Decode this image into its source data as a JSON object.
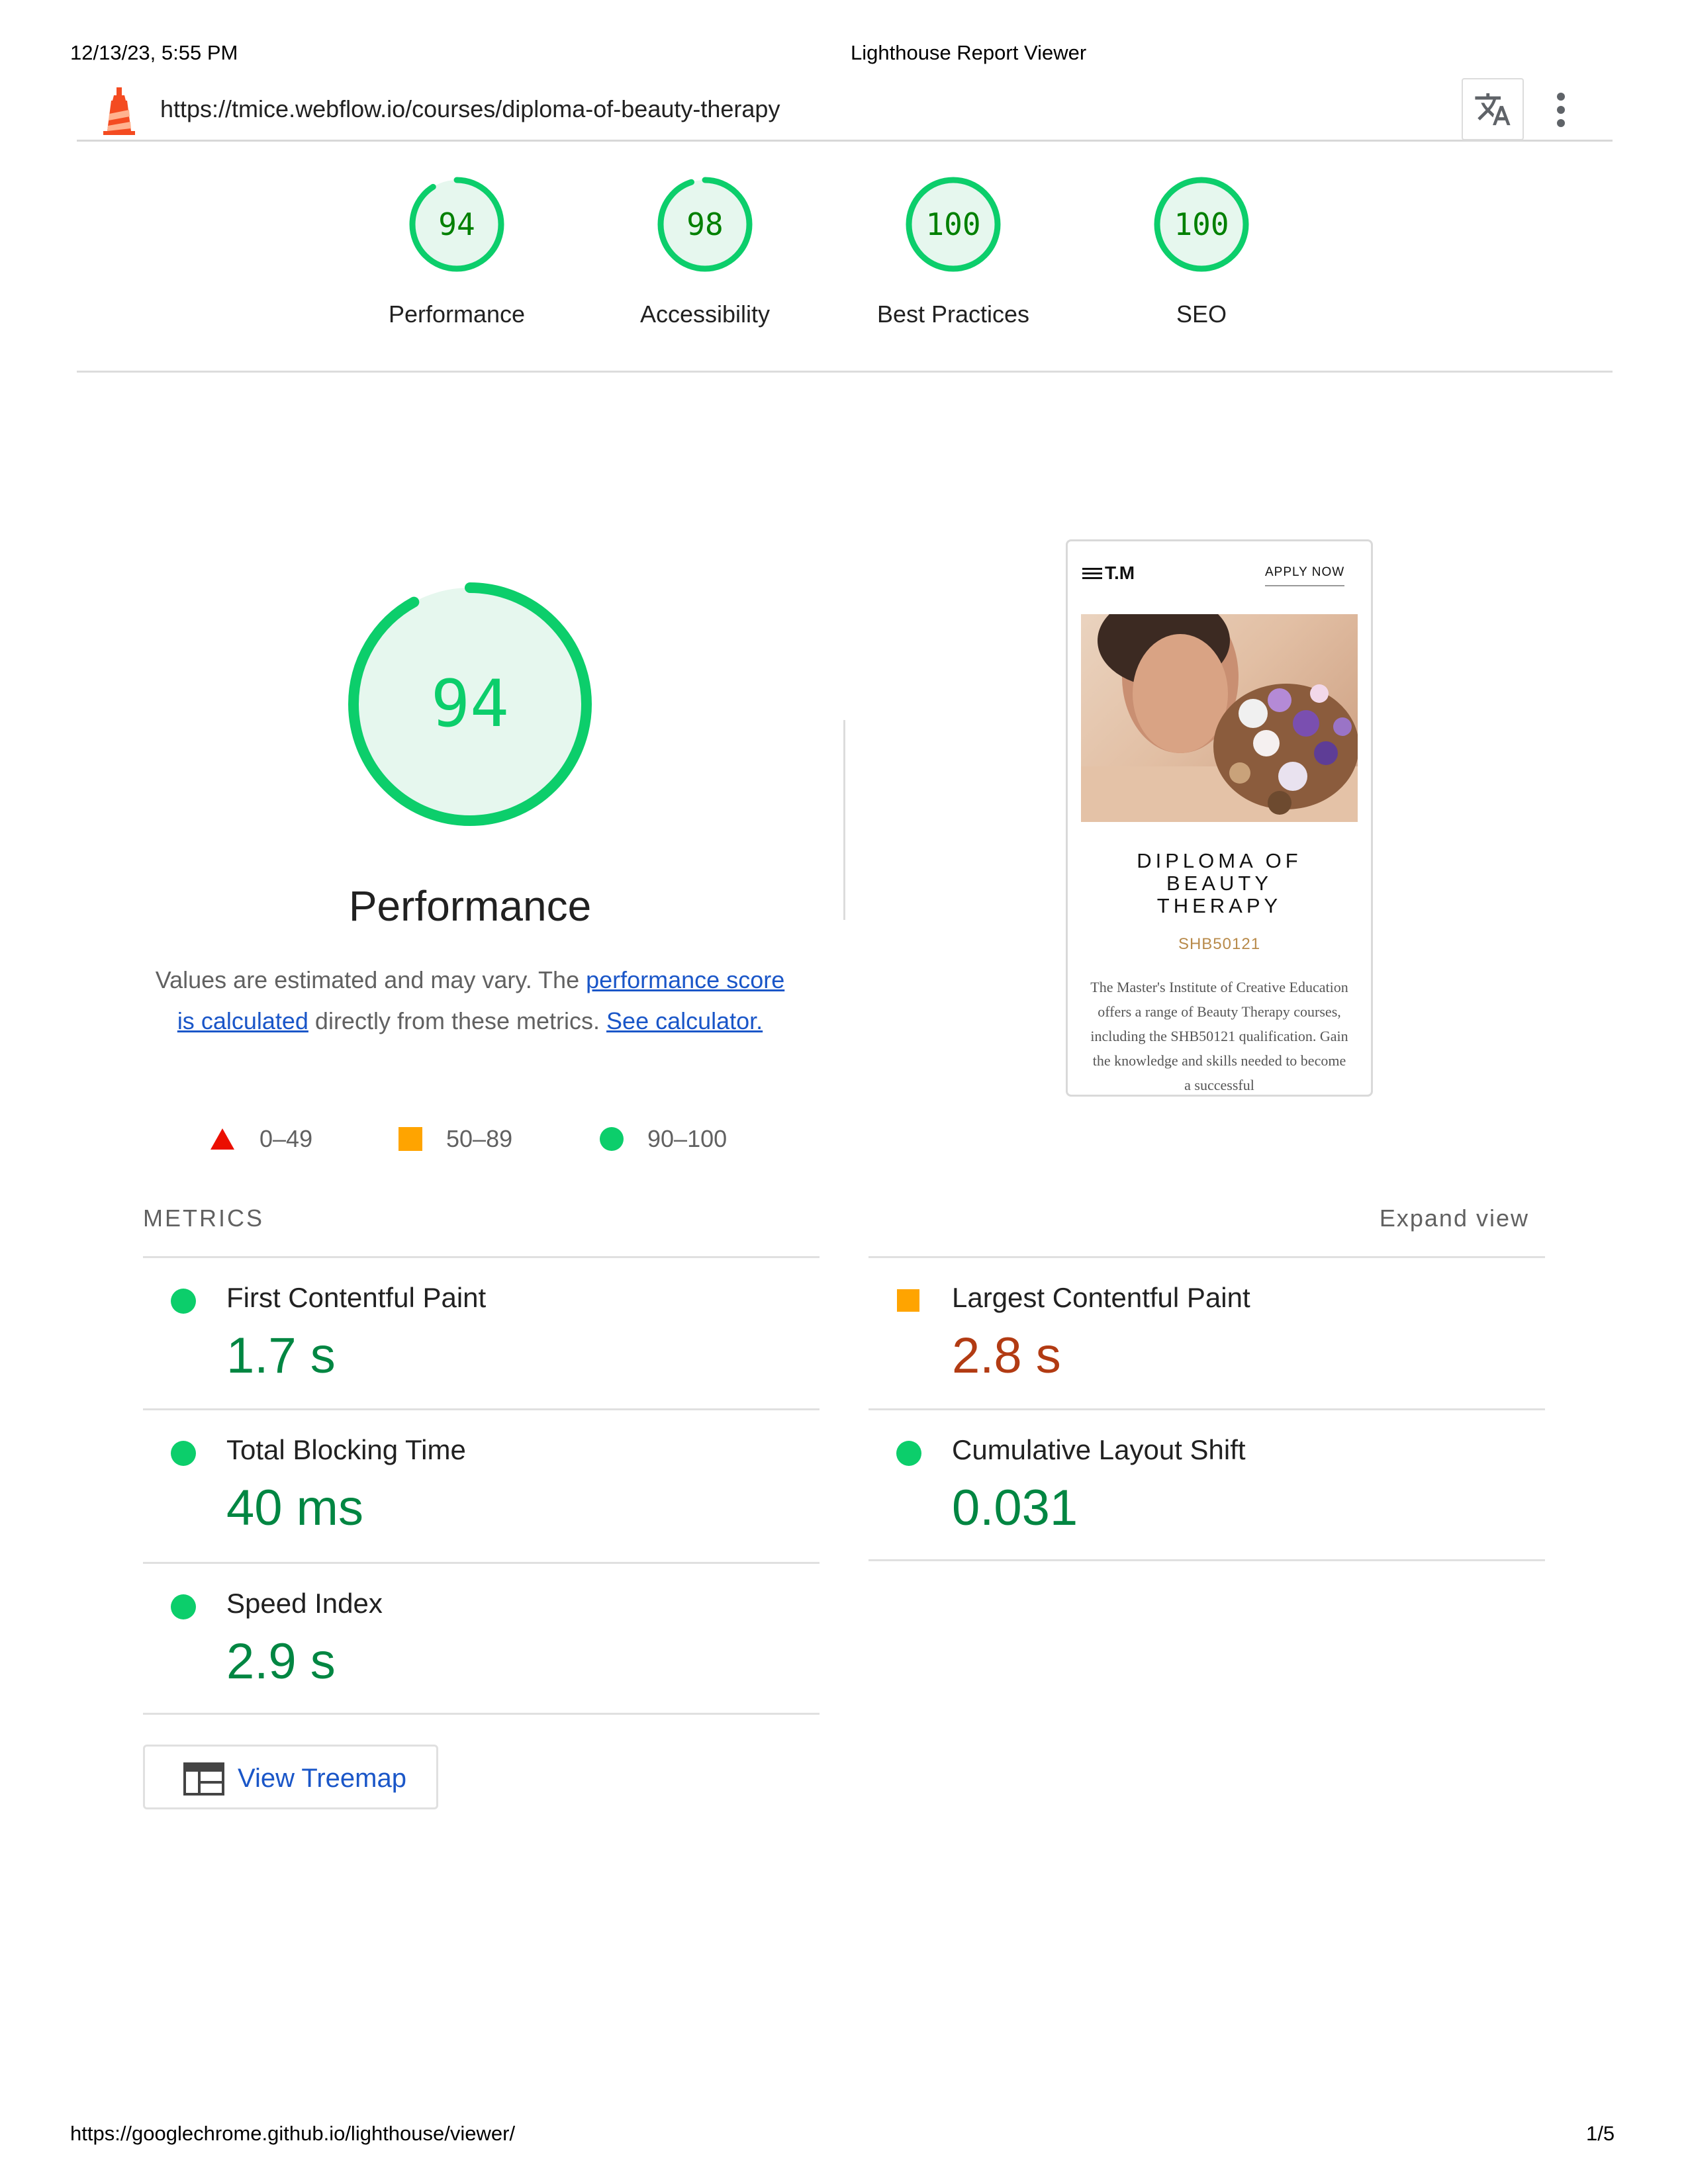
{
  "print_header": {
    "datetime": "12/13/23, 5:55 PM",
    "page_title": "Lighthouse Report Viewer"
  },
  "topbar": {
    "url": "https://tmice.webflow.io/courses/diploma-of-beauty-therapy",
    "translate_icon": "translate-icon",
    "menu_icon": "more-vert-icon"
  },
  "summary": [
    {
      "label": "Performance",
      "score": "94",
      "fraction": 0.94
    },
    {
      "label": "Accessibility",
      "score": "98",
      "fraction": 0.98
    },
    {
      "label": "Best Practices",
      "score": "100",
      "fraction": 1.0
    },
    {
      "label": "SEO",
      "score": "100",
      "fraction": 1.0
    }
  ],
  "performance": {
    "score": "94",
    "fraction": 0.94,
    "title": "Performance",
    "desc_before": "Values are estimated and may vary. The ",
    "desc_link1": "performance score is calculated",
    "desc_middle": " directly from these metrics. ",
    "desc_link2": "See calculator."
  },
  "legend": {
    "fail": "0–49",
    "average": "50–89",
    "pass": "90–100"
  },
  "screenshot": {
    "logo": "T.M",
    "apply": "APPLY NOW",
    "title_line1": "DIPLOMA OF",
    "title_line2": "BEAUTY",
    "title_line3": "THERAPY",
    "code": "SHB50121",
    "body_line1": "The Master's Institute of Creative Education",
    "body_line2": "offers a range of Beauty Therapy courses,",
    "body_line3": "including the SHB50121 qualification. Gain",
    "body_line4": "the knowledge and skills needed to become",
    "body_line5": "a successful"
  },
  "metrics": {
    "header": "METRICS",
    "expand": "Expand view",
    "fcp": {
      "label": "First Contentful Paint",
      "value": "1.7 s",
      "status": "pass"
    },
    "lcp": {
      "label": "Largest Contentful Paint",
      "value": "2.8 s",
      "status": "average"
    },
    "tbt": {
      "label": "Total Blocking Time",
      "value": "40 ms",
      "status": "pass"
    },
    "cls": {
      "label": "Cumulative Layout Shift",
      "value": "0.031",
      "status": "pass"
    },
    "si": {
      "label": "Speed Index",
      "value": "2.9 s",
      "status": "pass"
    }
  },
  "treemap": {
    "label": "View Treemap"
  },
  "print_footer": {
    "url": "https://googlechrome.github.io/lighthouse/viewer/",
    "page": "1/5"
  },
  "colors": {
    "pass": "#0cce6b",
    "pass_text": "#018642",
    "average": "#ffa400",
    "average_text": "#b23b13",
    "fail": "#ff3333",
    "pass_bg": "#e6f7ee",
    "link": "#1a56c8"
  }
}
